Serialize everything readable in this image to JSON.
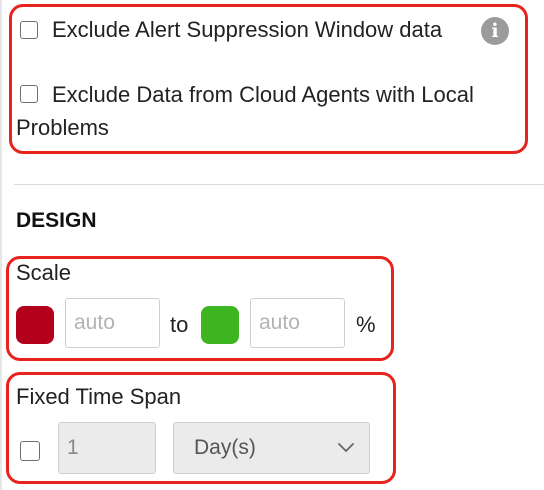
{
  "filters": {
    "exclude_alert_suppression": {
      "label": "Exclude Alert Suppression Window data",
      "checked": false,
      "info_icon": "info-icon"
    },
    "exclude_cloud_agents": {
      "label_line1": "Exclude Data from Cloud Agents with Local",
      "label_line2": "Problems",
      "checked": false
    }
  },
  "design": {
    "title": "DESIGN",
    "scale": {
      "label": "Scale",
      "min_color": "#b3001b",
      "min_placeholder": "auto",
      "to_label": "to",
      "max_color": "#3cb521",
      "max_placeholder": "auto",
      "unit": "%"
    },
    "fixed_time_span": {
      "label": "Fixed Time Span",
      "enabled": false,
      "value": "1",
      "unit_selected": "Day(s)"
    }
  },
  "colors": {
    "highlight": "#e8231e"
  }
}
